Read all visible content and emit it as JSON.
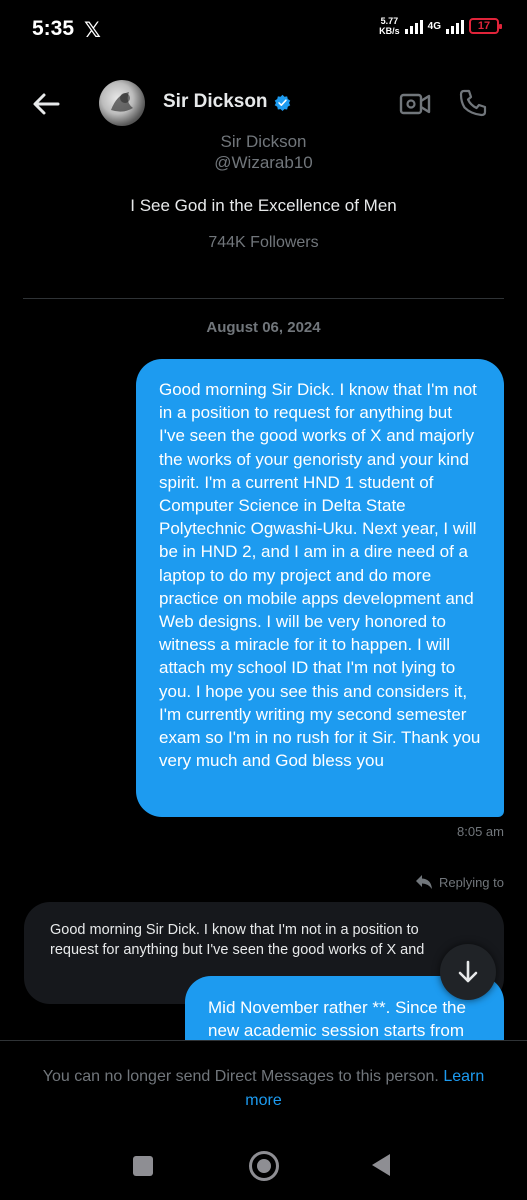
{
  "status_bar": {
    "time": "5:35",
    "app_glyph": "𝕏",
    "net_speed_value": "5.77",
    "net_speed_unit": "KB/s",
    "network_type": "4G",
    "battery_level": "17"
  },
  "header": {
    "contact_name": "Sir Dickson",
    "verified": true,
    "icons": [
      "back-arrow-icon",
      "verified-badge-icon",
      "video-call-icon",
      "phone-call-icon"
    ]
  },
  "profile": {
    "name_clipped": "Sir Dickson",
    "handle": "@Wizarab10",
    "bio": "I See God in the Excellence of Men",
    "followers": "744K Followers"
  },
  "conversation": {
    "date_separator": "August 06, 2024",
    "messages": [
      {
        "direction": "sent",
        "text": "Good morning Sir Dick. I know that I'm not in a position to request for anything but I've seen the good works of X and majorly the works of your genoristy and your kind spirit. I'm a current HND 1 student of Computer Science in Delta State Polytechnic Ogwashi-Uku. Next year, I will be in HND 2, and I am in a dire need of a laptop to do my project and do more practice on mobile apps development and Web designs. I will be very honored to witness a miracle for it to happen. I will attach my school ID that I'm not lying to you. I hope you see this and considers it, I'm currently writing my second semester exam so I'm in no rush for it Sir. Thank you very much and God bless you",
        "time": "8:05 am"
      }
    ],
    "reply_label": "Replying to",
    "quoted_text_line1": "Good morning Sir Dick. I know that I'm not in a position to",
    "quoted_text_line2": "request for anything but I've seen the good works of X and",
    "second_message_partial": "Mid November rather **. Since the new academic session starts from"
  },
  "notice": {
    "text": "You can no longer send Direct Messages to this person.",
    "link_label": "Learn more"
  },
  "colors": {
    "accent": "#1d9bf0",
    "background": "#000000",
    "muted_text": "#71767b",
    "battery_low": "#e0243a"
  }
}
